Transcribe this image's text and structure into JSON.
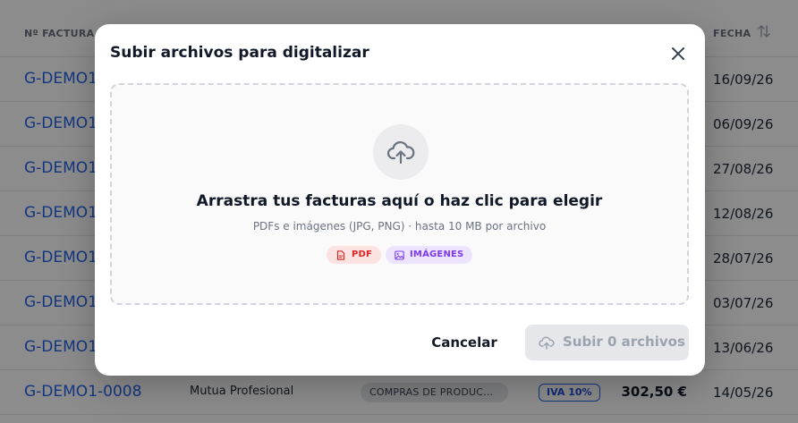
{
  "table": {
    "headers": {
      "number": "Nº FACTURA",
      "date": "FECHA"
    },
    "rows": [
      {
        "number": "G-DEMO1",
        "date": "16/09/26"
      },
      {
        "number": "G-DEMO1",
        "date": "06/09/26"
      },
      {
        "number": "G-DEMO1",
        "date": "27/08/26"
      },
      {
        "number": "G-DEMO1",
        "date": "12/08/26"
      },
      {
        "number": "G-DEMO1",
        "date": "28/07/26"
      },
      {
        "number": "G-DEMO1",
        "date": "03/07/26"
      },
      {
        "number": "G-DEMO1",
        "date": "13/06/26"
      },
      {
        "number": "G-DEMO1-0008",
        "client": "Mutua Profesional",
        "category": "COMPRAS DE PRODUC...",
        "iva": "IVA 10%",
        "amount": "302,50 €",
        "date": "14/05/26"
      }
    ]
  },
  "modal": {
    "title": "Subir archivos para digitalizar",
    "dropzone": {
      "title": "Arrastra tus facturas aquí o haz clic para elegir",
      "subtitle": "PDFs e imágenes (JPG, PNG) · hasta 10 MB por archivo",
      "chips": {
        "pdf": "PDF",
        "images": "IMÁGENES"
      }
    },
    "cancel_label": "Cancelar",
    "submit_label": "Subir 0 archivos"
  },
  "icons": {
    "upload": "cloud-upload-icon",
    "close": "close-icon",
    "pdf": "pdf-file-icon",
    "image": "image-icon",
    "sort": "sort-icon"
  },
  "colors": {
    "link": "#2563eb",
    "pdf_chip_bg": "#fde2e2",
    "pdf_chip_text": "#dc2626",
    "img_chip_bg": "#ede5ff",
    "img_chip_text": "#7c3aed",
    "disabled_button": "#e5e7eb"
  }
}
